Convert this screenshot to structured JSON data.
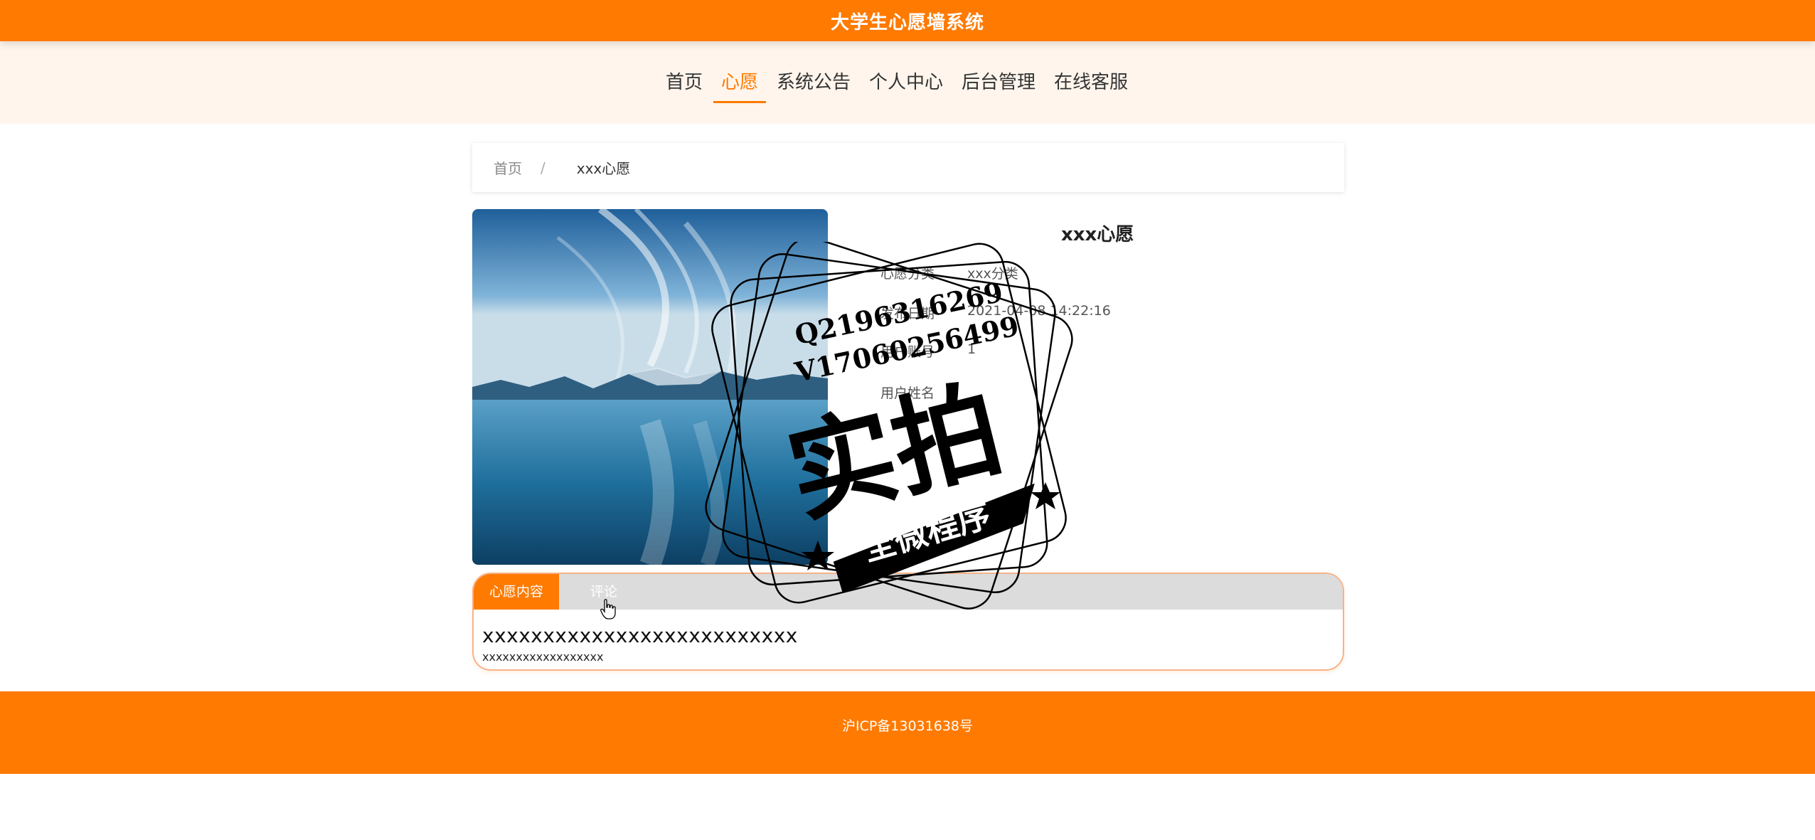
{
  "header": {
    "title": "大学生心愿墙系统"
  },
  "nav": {
    "items": [
      {
        "label": "首页"
      },
      {
        "label": "心愿"
      },
      {
        "label": "系统公告"
      },
      {
        "label": "个人中心"
      },
      {
        "label": "后台管理"
      },
      {
        "label": "在线客服"
      }
    ],
    "active_index": 1
  },
  "breadcrumb": {
    "home": "首页",
    "separator": "/",
    "current": "xxx心愿"
  },
  "detail": {
    "title": "xxx心愿",
    "meta": [
      {
        "key": "心愿分类",
        "value": "xxx分类"
      },
      {
        "key": "发布日期",
        "value": "2021-04-08 14:22:16"
      },
      {
        "key": "用户账号",
        "value": "1"
      },
      {
        "key": "用户姓名",
        "value": ""
      }
    ]
  },
  "tabs": {
    "items": [
      {
        "label": "心愿内容"
      },
      {
        "label": "评论"
      }
    ],
    "content_title": "xxxxxxxxxxxxxxxxxxxxxxxxxx",
    "content_body": "xxxxxxxxxxxxxxxxxx"
  },
  "watermark": {
    "line1": "Q2196316269",
    "line2": "V17060256499",
    "big": "实拍",
    "banner": "全微程序"
  },
  "footer": {
    "icp": "沪ICP备13031638号"
  },
  "colors": {
    "primary": "#ff7a00",
    "nav_bg": "#fff5ec",
    "tab_bar": "#dcdcdc"
  }
}
